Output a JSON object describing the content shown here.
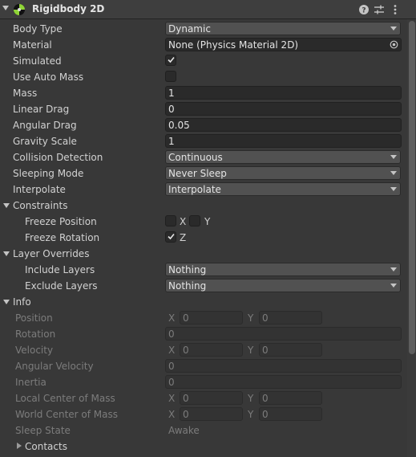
{
  "header": {
    "title": "Rigidbody 2D",
    "icons": [
      "physics-component-icon",
      "help-icon",
      "preset-icon",
      "more-menu-icon"
    ],
    "accent_color": "#8ed336"
  },
  "fields": {
    "body_type": {
      "label": "Body Type",
      "value": "Dynamic"
    },
    "material": {
      "label": "Material",
      "value": "None (Physics Material 2D)"
    },
    "simulated": {
      "label": "Simulated",
      "checked": true
    },
    "use_auto_mass": {
      "label": "Use Auto Mass",
      "checked": false
    },
    "mass": {
      "label": "Mass",
      "value": "1"
    },
    "linear_drag": {
      "label": "Linear Drag",
      "value": "0"
    },
    "angular_drag": {
      "label": "Angular Drag",
      "value": "0.05"
    },
    "gravity_scale": {
      "label": "Gravity Scale",
      "value": "1"
    },
    "collision_detection": {
      "label": "Collision Detection",
      "value": "Continuous"
    },
    "sleeping_mode": {
      "label": "Sleeping Mode",
      "value": "Never Sleep"
    },
    "interpolate": {
      "label": "Interpolate",
      "value": "Interpolate"
    }
  },
  "constraints": {
    "label": "Constraints",
    "freeze_position": {
      "label": "Freeze Position",
      "x_label": "X",
      "y_label": "Y",
      "x": false,
      "y": false
    },
    "freeze_rotation": {
      "label": "Freeze Rotation",
      "z_label": "Z",
      "z": true
    }
  },
  "layer_overrides": {
    "label": "Layer Overrides",
    "include_layers": {
      "label": "Include Layers",
      "value": "Nothing"
    },
    "exclude_layers": {
      "label": "Exclude Layers",
      "value": "Nothing"
    }
  },
  "info": {
    "label": "Info",
    "position": {
      "label": "Position",
      "x_label": "X",
      "y_label": "Y",
      "x": "0",
      "y": "0"
    },
    "rotation": {
      "label": "Rotation",
      "value": "0"
    },
    "velocity": {
      "label": "Velocity",
      "x_label": "X",
      "y_label": "Y",
      "x": "0",
      "y": "0"
    },
    "angular_velocity": {
      "label": "Angular Velocity",
      "value": "0"
    },
    "inertia": {
      "label": "Inertia",
      "value": "0"
    },
    "local_center_of_mass": {
      "label": "Local Center of Mass",
      "x_label": "X",
      "y_label": "Y",
      "x": "0",
      "y": "0"
    },
    "world_center_of_mass": {
      "label": "World Center of Mass",
      "x_label": "X",
      "y_label": "Y",
      "x": "0",
      "y": "0"
    },
    "sleep_state": {
      "label": "Sleep State",
      "value": "Awake"
    },
    "contacts": {
      "label": "Contacts"
    }
  }
}
